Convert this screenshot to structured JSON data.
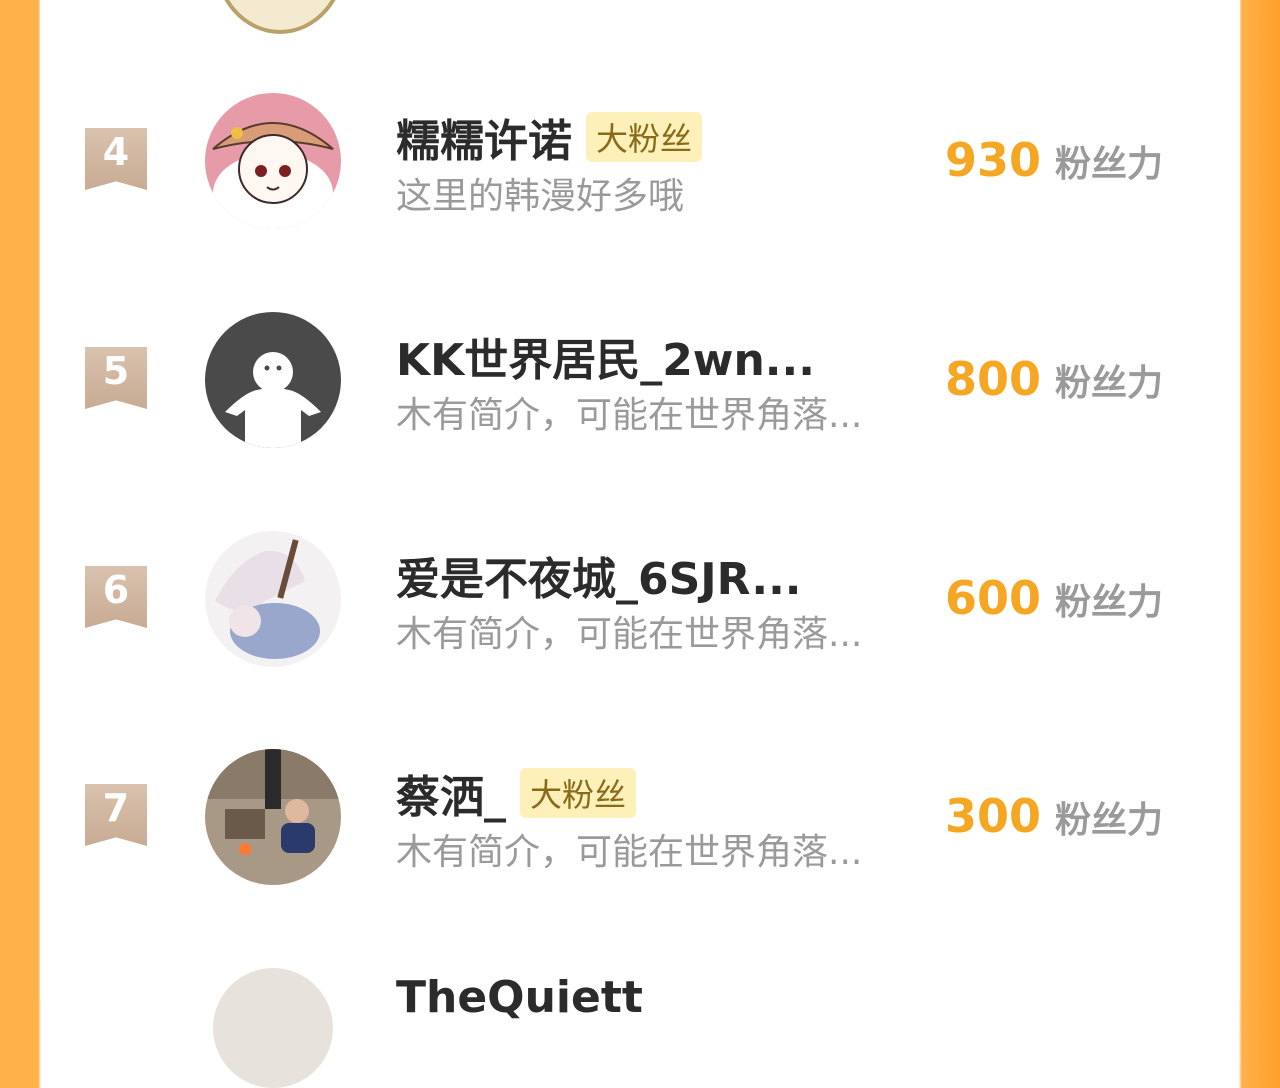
{
  "top_cut": {
    "avatar": "avatar-partial"
  },
  "rows": [
    {
      "rank": "4",
      "name": "糯糯许诺",
      "badge": "大粉丝",
      "bio": "这里的韩漫好多哦",
      "score": "930",
      "unit": "粉丝力",
      "avatar": "anime-girl-avatar"
    },
    {
      "rank": "5",
      "name": "KK世界居民_2wn...",
      "badge": "",
      "bio": "木有简介，可能在世界角落...",
      "score": "800",
      "unit": "粉丝力",
      "avatar": "default-user-avatar"
    },
    {
      "rank": "6",
      "name": "爱是不夜城_6SJR...",
      "badge": "",
      "bio": "木有简介，可能在世界角落...",
      "score": "600",
      "unit": "粉丝力",
      "avatar": "illustration-avatar"
    },
    {
      "rank": "7",
      "name": "蔡洒_",
      "badge": "大粉丝",
      "bio": "木有简介，可能在世界角落...",
      "score": "300",
      "unit": "粉丝力",
      "avatar": "photo-avatar"
    }
  ],
  "next_row": {
    "name": "TheQuiett"
  },
  "colors": {
    "accent": "#f5a623",
    "rank_bg": "#c8ab93",
    "badge_bg": "#fdf0b8",
    "side": "#ffb24a"
  }
}
